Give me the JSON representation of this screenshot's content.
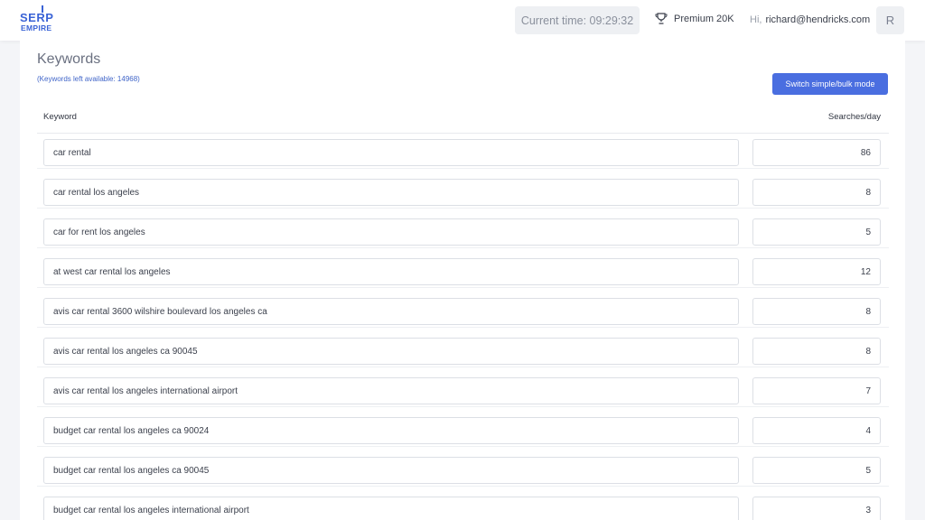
{
  "header": {
    "logo_top": "SERP",
    "logo_bottom": "EMPIRE",
    "current_time": "Current time: 09:29:32",
    "plan": "Premium 20K",
    "greeting": "Hi,",
    "email": "richard@hendricks.com",
    "avatar_letter": "R"
  },
  "page": {
    "title": "Keywords",
    "keywords_left": "(Keywords left available: 14968)",
    "switch_button": "Switch simple/bulk mode",
    "col_keyword": "Keyword",
    "col_searches": "Searches/day"
  },
  "rows": [
    {
      "keyword": "car rental",
      "searches": "86"
    },
    {
      "keyword": "car rental los angeles",
      "searches": "8"
    },
    {
      "keyword": "car for rent los angeles",
      "searches": "5"
    },
    {
      "keyword": "at west car rental los angeles",
      "searches": "12"
    },
    {
      "keyword": "avis car rental 3600 wilshire boulevard los angeles ca",
      "searches": "8"
    },
    {
      "keyword": "avis car rental los angeles ca 90045",
      "searches": "8"
    },
    {
      "keyword": "avis car rental los angeles international airport",
      "searches": "7"
    },
    {
      "keyword": "budget car rental los angeles ca 90024",
      "searches": "4"
    },
    {
      "keyword": "budget car rental los angeles ca 90045",
      "searches": "5"
    },
    {
      "keyword": "budget car rental los angeles international airport",
      "searches": "3"
    }
  ]
}
